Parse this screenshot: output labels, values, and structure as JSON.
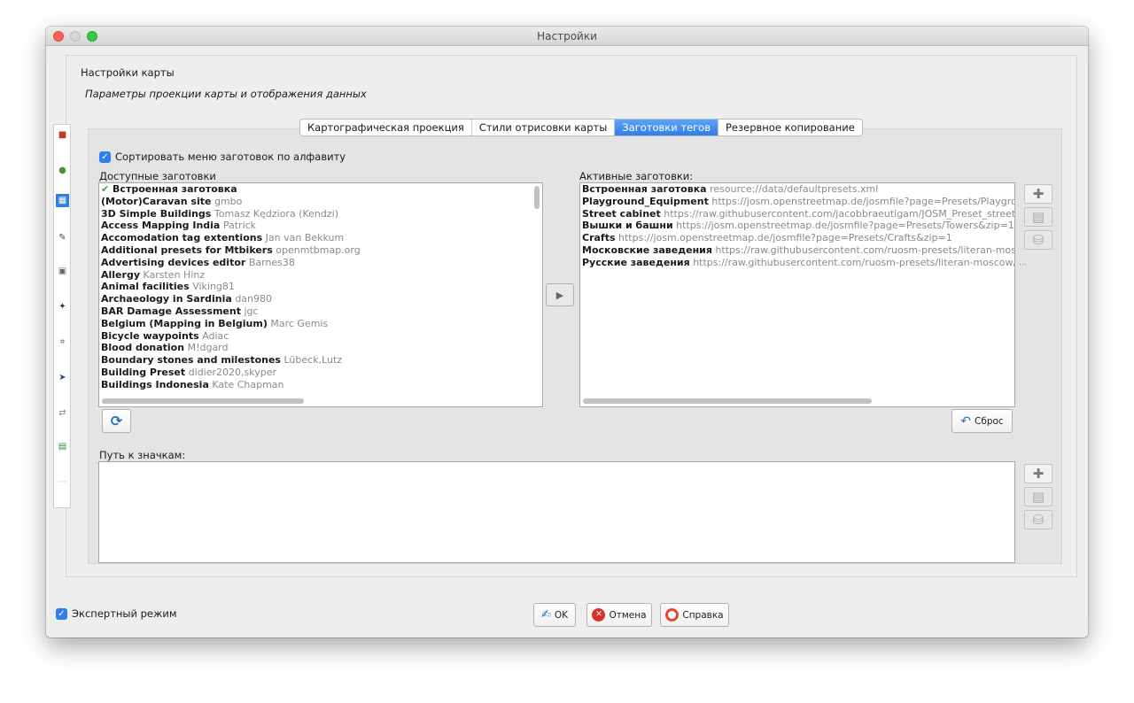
{
  "window": {
    "title": "Настройки"
  },
  "header": {
    "title": "Настройки карты",
    "subtitle": "Параметры проекции карты и отображения данных"
  },
  "tabs": [
    {
      "label": "Картографическая проекция",
      "active": false
    },
    {
      "label": "Стили отрисовки карты",
      "active": false
    },
    {
      "label": "Заготовки тегов",
      "active": true
    },
    {
      "label": "Резервное копирование",
      "active": false
    }
  ],
  "sort_option": {
    "label": "Сортировать меню заготовок по алфавиту",
    "checked": true
  },
  "available": {
    "label": "Доступные заготовки",
    "items": [
      {
        "name": "Встроенная заготовка",
        "author": "",
        "checked": true
      },
      {
        "name": "(Motor)Caravan site",
        "author": "gmbo"
      },
      {
        "name": "3D Simple Buildings",
        "author": "Tomasz Kędziora (Kendzi)"
      },
      {
        "name": "Access Mapping India",
        "author": "Patrick"
      },
      {
        "name": "Accomodation tag extentions",
        "author": "Jan van Bekkum"
      },
      {
        "name": "Additional presets for Mtbikers",
        "author": "openmtbmap.org"
      },
      {
        "name": "Advertising devices editor",
        "author": "Barnes38"
      },
      {
        "name": "Allergy",
        "author": "Karsten Hinz"
      },
      {
        "name": "Animal facilities",
        "author": "Viking81"
      },
      {
        "name": "Archaeology in Sardinia",
        "author": "dan980"
      },
      {
        "name": "BAR Damage Assessment",
        "author": "jgc"
      },
      {
        "name": "Belgium (Mapping in Belgium)",
        "author": "Marc Gemis"
      },
      {
        "name": "Bicycle waypoints",
        "author": "Adiac"
      },
      {
        "name": "Blood donation",
        "author": "M!dgard"
      },
      {
        "name": "Boundary stones and milestones",
        "author": "Lübeck,Lutz"
      },
      {
        "name": "Building Preset",
        "author": "didier2020,skyper"
      },
      {
        "name": "Buildings Indonesia",
        "author": "Kate Chapman"
      }
    ]
  },
  "active": {
    "label": "Активные заготовки:",
    "items": [
      {
        "name": "Встроенная заготовка",
        "author": "resource://data/defaultpresets.xml"
      },
      {
        "name": "Playground_Equipment",
        "author": "https://josm.openstreetmap.de/josmfile?page=Presets/Playgroun"
      },
      {
        "name": "Street cabinet",
        "author": "https://raw.githubusercontent.com/jacobbraeutigam/JOSM_Preset_street_cal"
      },
      {
        "name": "Вышки и башни",
        "author": "https://josm.openstreetmap.de/josmfile?page=Presets/Towers&zip=1"
      },
      {
        "name": "Crafts",
        "author": "https://josm.openstreetmap.de/josmfile?page=Presets/Crafts&zip=1"
      },
      {
        "name": "Московские заведения",
        "author": "https://raw.githubusercontent.com/ruosm-presets/literan-moscov"
      },
      {
        "name": "Русские заведения",
        "author": "https://raw.githubusercontent.com/ruosm-presets/literan-moscow/ma"
      }
    ],
    "ellipsis": "..."
  },
  "buttons": {
    "reset": "Сброс",
    "ok": "OK",
    "cancel": "Отмена",
    "help": "Справка"
  },
  "icon_path": {
    "label": "Путь к значкам:"
  },
  "expert_mode": {
    "label": "Экспертный режим",
    "checked": true
  },
  "colors": {
    "accent": "#2f7de8",
    "selected_tab": "#3b8cf0"
  }
}
